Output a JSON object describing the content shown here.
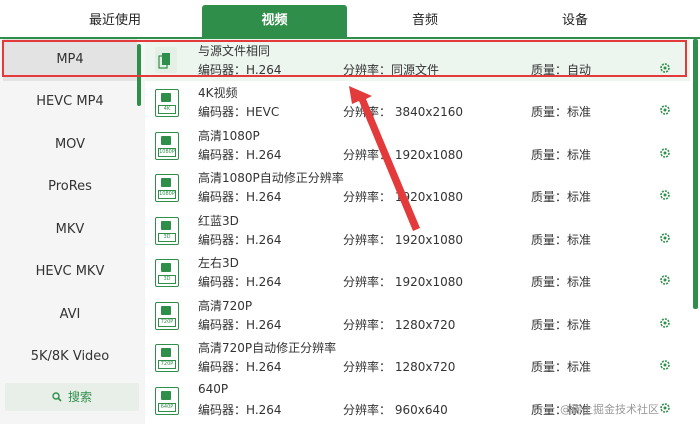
{
  "tabs": [
    {
      "label": "最近使用"
    },
    {
      "label": "视频"
    },
    {
      "label": "音频"
    },
    {
      "label": "设备"
    }
  ],
  "sidebar": {
    "items": [
      {
        "label": "MP4"
      },
      {
        "label": "HEVC MP4"
      },
      {
        "label": "MOV"
      },
      {
        "label": "ProRes"
      },
      {
        "label": "MKV"
      },
      {
        "label": "HEVC MKV"
      },
      {
        "label": "AVI"
      },
      {
        "label": "5K/8K Video"
      }
    ],
    "search_label": "搜索"
  },
  "presets": [
    {
      "name": "与源文件相同",
      "codec": "编码器：H.264",
      "resolution": "分辨率：同源文件",
      "quality": "质量：自动",
      "badge": ""
    },
    {
      "name": "4K视频",
      "codec": "编码器：HEVC",
      "resolution": "分辨率：  3840x2160",
      "quality": "质量：标准",
      "badge": "4K"
    },
    {
      "name": "高清1080P",
      "codec": "编码器：H.264",
      "resolution": "分辨率：  1920x1080",
      "quality": "质量：标准",
      "badge": "1080P"
    },
    {
      "name": "高清1080P自动修正分辨率",
      "codec": "编码器：H.264",
      "resolution": "分辨率：  1920x1080",
      "quality": "质量：标准",
      "badge": "1080P"
    },
    {
      "name": "红蓝3D",
      "codec": "编码器：H.264",
      "resolution": "分辨率：  1920x1080",
      "quality": "质量：标准",
      "badge": "3D"
    },
    {
      "name": "左右3D",
      "codec": "编码器：H.264",
      "resolution": "分辨率：  1920x1080",
      "quality": "质量：标准",
      "badge": "3D"
    },
    {
      "name": "高清720P",
      "codec": "编码器：H.264",
      "resolution": "分辨率：  1280x720",
      "quality": "质量：标准",
      "badge": "720P"
    },
    {
      "name": "高清720P自动修正分辨率",
      "codec": "编码器：H.264",
      "resolution": "分辨率：  1280x720",
      "quality": "质量：标准",
      "badge": "720P"
    },
    {
      "name": "640P",
      "codec": "编码器：H.264",
      "resolution": "分辨率：  960x640",
      "quality": "质量：标准",
      "badge": "640P"
    }
  ],
  "watermark": "@稀土掘金技术社区",
  "colors": {
    "accent": "#2f8f4a",
    "highlight": "#e33b3b"
  }
}
